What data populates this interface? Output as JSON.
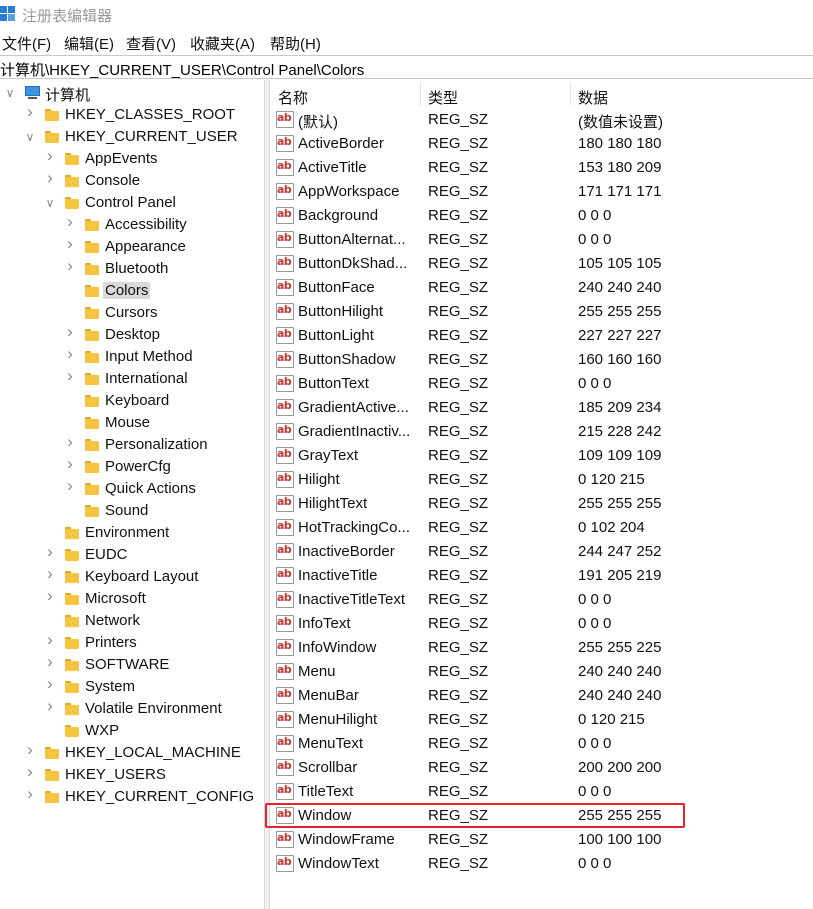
{
  "window": {
    "title": "注册表编辑器",
    "icon": "regedit-icon"
  },
  "menu": [
    "文件(F)",
    "编辑(E)",
    "查看(V)",
    "收藏夹(A)",
    "帮助(H)"
  ],
  "address": "计算机\\HKEY_CURRENT_USER\\Control Panel\\Colors",
  "tree": {
    "root": "计算机",
    "hives": {
      "classes_root": "HKEY_CLASSES_ROOT",
      "current_user": "HKEY_CURRENT_USER",
      "local_machine": "HKEY_LOCAL_MACHINE",
      "users": "HKEY_USERS",
      "current_config": "HKEY_CURRENT_CONFIG"
    },
    "current_user_children": {
      "app_events": "AppEvents",
      "console": "Console",
      "control_panel": "Control Panel",
      "environment": "Environment",
      "eudc": "EUDC",
      "keyboard_layout": "Keyboard Layout",
      "microsoft": "Microsoft",
      "network": "Network",
      "printers": "Printers",
      "software": "SOFTWARE",
      "system": "System",
      "volatile_environment": "Volatile Environment",
      "wxp": "WXP"
    },
    "control_panel_children": [
      "Accessibility",
      "Appearance",
      "Bluetooth",
      "Colors",
      "Cursors",
      "Desktop",
      "Input Method",
      "International",
      "Keyboard",
      "Mouse",
      "Personalization",
      "PowerCfg",
      "Quick Actions",
      "Sound"
    ],
    "selected": "Colors"
  },
  "columns": {
    "name": "名称",
    "type": "类型",
    "data": "数据"
  },
  "values": [
    {
      "name": "(默认)",
      "type": "REG_SZ",
      "data": "(数值未设置)"
    },
    {
      "name": "ActiveBorder",
      "type": "REG_SZ",
      "data": "180 180 180"
    },
    {
      "name": "ActiveTitle",
      "type": "REG_SZ",
      "data": "153 180 209"
    },
    {
      "name": "AppWorkspace",
      "type": "REG_SZ",
      "data": "171 171 171"
    },
    {
      "name": "Background",
      "type": "REG_SZ",
      "data": "0 0 0"
    },
    {
      "name": "ButtonAlternat...",
      "type": "REG_SZ",
      "data": "0 0 0"
    },
    {
      "name": "ButtonDkShad...",
      "type": "REG_SZ",
      "data": "105 105 105"
    },
    {
      "name": "ButtonFace",
      "type": "REG_SZ",
      "data": "240 240 240"
    },
    {
      "name": "ButtonHilight",
      "type": "REG_SZ",
      "data": "255 255 255"
    },
    {
      "name": "ButtonLight",
      "type": "REG_SZ",
      "data": "227 227 227"
    },
    {
      "name": "ButtonShadow",
      "type": "REG_SZ",
      "data": "160 160 160"
    },
    {
      "name": "ButtonText",
      "type": "REG_SZ",
      "data": "0 0 0"
    },
    {
      "name": "GradientActive...",
      "type": "REG_SZ",
      "data": "185 209 234"
    },
    {
      "name": "GradientInactiv...",
      "type": "REG_SZ",
      "data": "215 228 242"
    },
    {
      "name": "GrayText",
      "type": "REG_SZ",
      "data": "109 109 109"
    },
    {
      "name": "Hilight",
      "type": "REG_SZ",
      "data": "0 120 215"
    },
    {
      "name": "HilightText",
      "type": "REG_SZ",
      "data": "255 255 255"
    },
    {
      "name": "HotTrackingCo...",
      "type": "REG_SZ",
      "data": "0 102 204"
    },
    {
      "name": "InactiveBorder",
      "type": "REG_SZ",
      "data": "244 247 252"
    },
    {
      "name": "InactiveTitle",
      "type": "REG_SZ",
      "data": "191 205 219"
    },
    {
      "name": "InactiveTitleText",
      "type": "REG_SZ",
      "data": "0 0 0"
    },
    {
      "name": "InfoText",
      "type": "REG_SZ",
      "data": "0 0 0"
    },
    {
      "name": "InfoWindow",
      "type": "REG_SZ",
      "data": "255 255 225"
    },
    {
      "name": "Menu",
      "type": "REG_SZ",
      "data": "240 240 240"
    },
    {
      "name": "MenuBar",
      "type": "REG_SZ",
      "data": "240 240 240"
    },
    {
      "name": "MenuHilight",
      "type": "REG_SZ",
      "data": "0 120 215"
    },
    {
      "name": "MenuText",
      "type": "REG_SZ",
      "data": "0 0 0"
    },
    {
      "name": "Scrollbar",
      "type": "REG_SZ",
      "data": "200 200 200"
    },
    {
      "name": "TitleText",
      "type": "REG_SZ",
      "data": "0 0 0"
    },
    {
      "name": "Window",
      "type": "REG_SZ",
      "data": "255 255 255"
    },
    {
      "name": "WindowFrame",
      "type": "REG_SZ",
      "data": "100 100 100"
    },
    {
      "name": "WindowText",
      "type": "REG_SZ",
      "data": "0 0 0"
    }
  ],
  "value_icon_text": "ab",
  "highlighted_value": "Window",
  "colors": {
    "highlight_border": "#e8222a",
    "selection_bg": "#d9d9d9",
    "folder": "#f5c542"
  }
}
